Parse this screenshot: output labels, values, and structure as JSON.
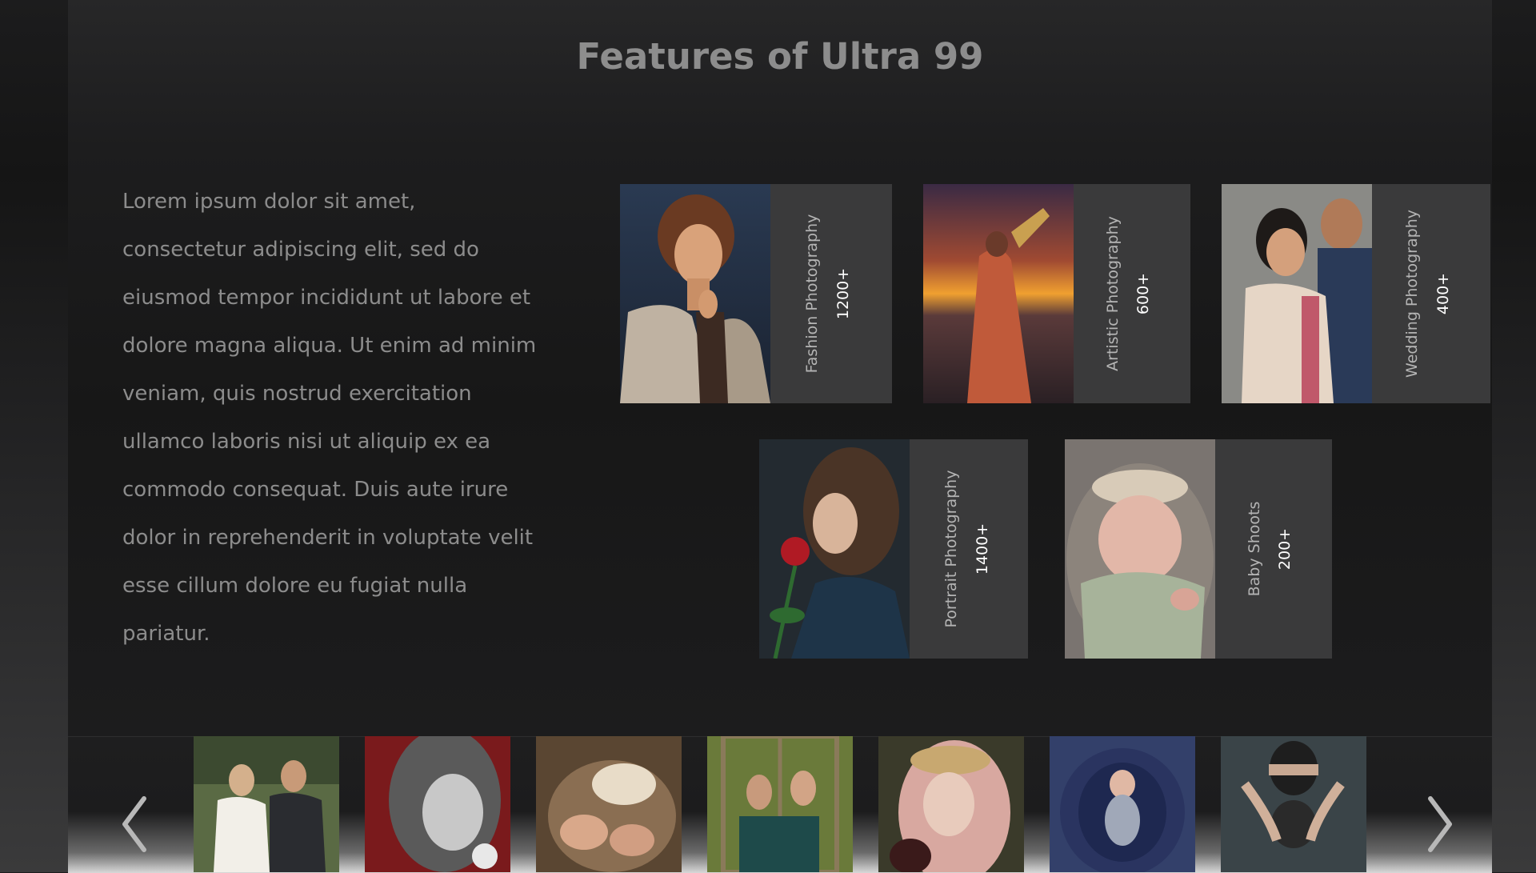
{
  "page": {
    "title": "Features of Ultra 99",
    "description": "Lorem ipsum dolor sit amet, consectetur adipiscing elit, sed do eiusmod tempor incididunt ut labore et dolore magna aliqua. Ut enim ad minim veniam, quis nostrud exercitation ullamco laboris nisi ut aliquip ex ea commodo consequat. Duis aute irure dolor in reprehenderit in voluptate velit esse cillum dolore eu fugiat nulla pariatur."
  },
  "features": [
    {
      "label": "Fashion Photography",
      "count": "1200+"
    },
    {
      "label": "Artistic Photography",
      "count": "600+"
    },
    {
      "label": "Wedding Photography",
      "count": "400+"
    },
    {
      "label": "Portrait Photography",
      "count": "1400+"
    },
    {
      "label": "Baby Shoots",
      "count": "200+"
    }
  ],
  "gallery": {
    "prev_icon": "chevron-left-icon",
    "next_icon": "chevron-right-icon",
    "thumbnails": [
      "wedding-couple-thumbnail",
      "woman-red-hood-thumbnail",
      "sleeping-newborns-thumbnail",
      "two-women-window-thumbnail",
      "crowned-woman-thumbnail",
      "newborn-blue-blanket-thumbnail",
      "hands-over-eyes-thumbnail"
    ]
  },
  "colors": {
    "background": "#1b1b1c",
    "panel": "#1d1d1e",
    "title": "#8d8d8d",
    "body_text": "#8c8c8c",
    "card_meta": "#3a3a3b",
    "card_label": "#b4b4b4",
    "card_count": "#ffffff"
  }
}
